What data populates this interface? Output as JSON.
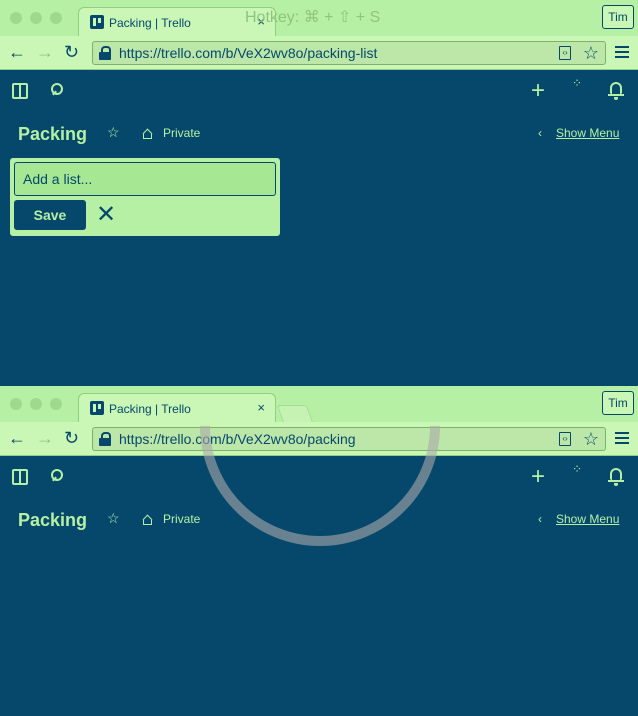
{
  "hotkey_overlay": "Hotkey: ⌘ + ⇧ + S",
  "windows": [
    {
      "tab": {
        "title": "Packing | Trello",
        "close": "×"
      },
      "profile": "Tim",
      "toolbar": {
        "back": "←",
        "forward": "→",
        "reload": "↻",
        "url": "https://trello.com/b/VeX2wv8o/packing-list",
        "star": "☆"
      },
      "header": {
        "plus": "+",
        "sparkle": "⁘"
      },
      "board": {
        "title": "Packing",
        "star": "☆",
        "visibility": "Private",
        "chevron": "‹",
        "show_menu": "Show Menu"
      },
      "composer": {
        "placeholder": "Add a list...",
        "save_label": "Save",
        "close_glyph": "✕"
      }
    },
    {
      "tab": {
        "title": "Packing | Trello",
        "close": "×"
      },
      "profile": "Tim",
      "toolbar": {
        "back": "←",
        "forward": "→",
        "reload": "↻",
        "url": "https://trello.com/b/VeX2wv8o/packing",
        "star": "☆"
      },
      "header": {
        "plus": "+",
        "sparkle": "⁘"
      },
      "board": {
        "title": "Packing",
        "star": "☆",
        "visibility": "Private",
        "chevron": "‹",
        "show_menu": "Show Menu"
      }
    }
  ],
  "colors": {
    "board_background": "#05486b",
    "chrome_background": "#caf7b6",
    "accent": "#b6f0a4"
  }
}
